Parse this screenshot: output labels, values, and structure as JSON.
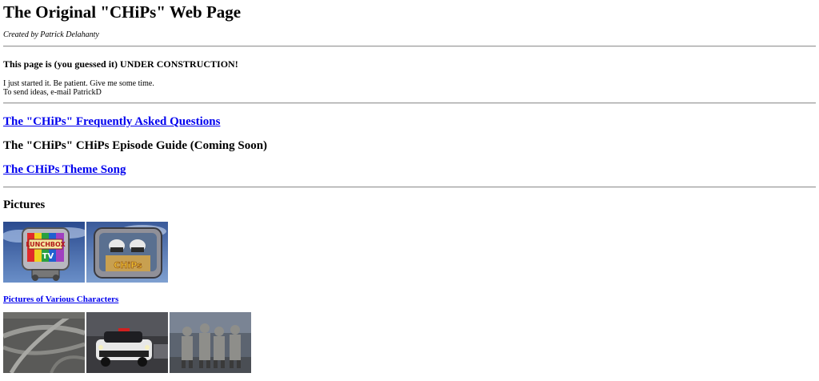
{
  "title": "The Original \"CHiPs\" Web Page",
  "credit": "Created by Patrick Delahanty",
  "construction": "This page is (you guessed it) UNDER CONSTRUCTION!",
  "note_line1": "I just started it. Be patient. Give me some time.",
  "note_line2": "To send ideas, e-mail PatrickD",
  "links": {
    "faq": "The \"CHiPs\" Frequently Asked Questions",
    "guide": "The \"CHiPs\" CHiPs Episode Guide (Coming Soon)",
    "theme": "The CHiPs Theme Song"
  },
  "pictures_heading": "Pictures",
  "characters_link": "Pictures of Various Characters",
  "images_row1": [
    {
      "name": "lunchbox-tv-image",
      "desc": "Lunchbox TV logo"
    },
    {
      "name": "chips-officers-tv-image",
      "desc": "CHiPs officers on TV"
    }
  ],
  "images_row2": [
    {
      "name": "freeway-interchange-image",
      "desc": "Freeway interchange"
    },
    {
      "name": "police-car-image",
      "desc": "Police car"
    },
    {
      "name": "officers-group-image",
      "desc": "Group of officers"
    }
  ]
}
